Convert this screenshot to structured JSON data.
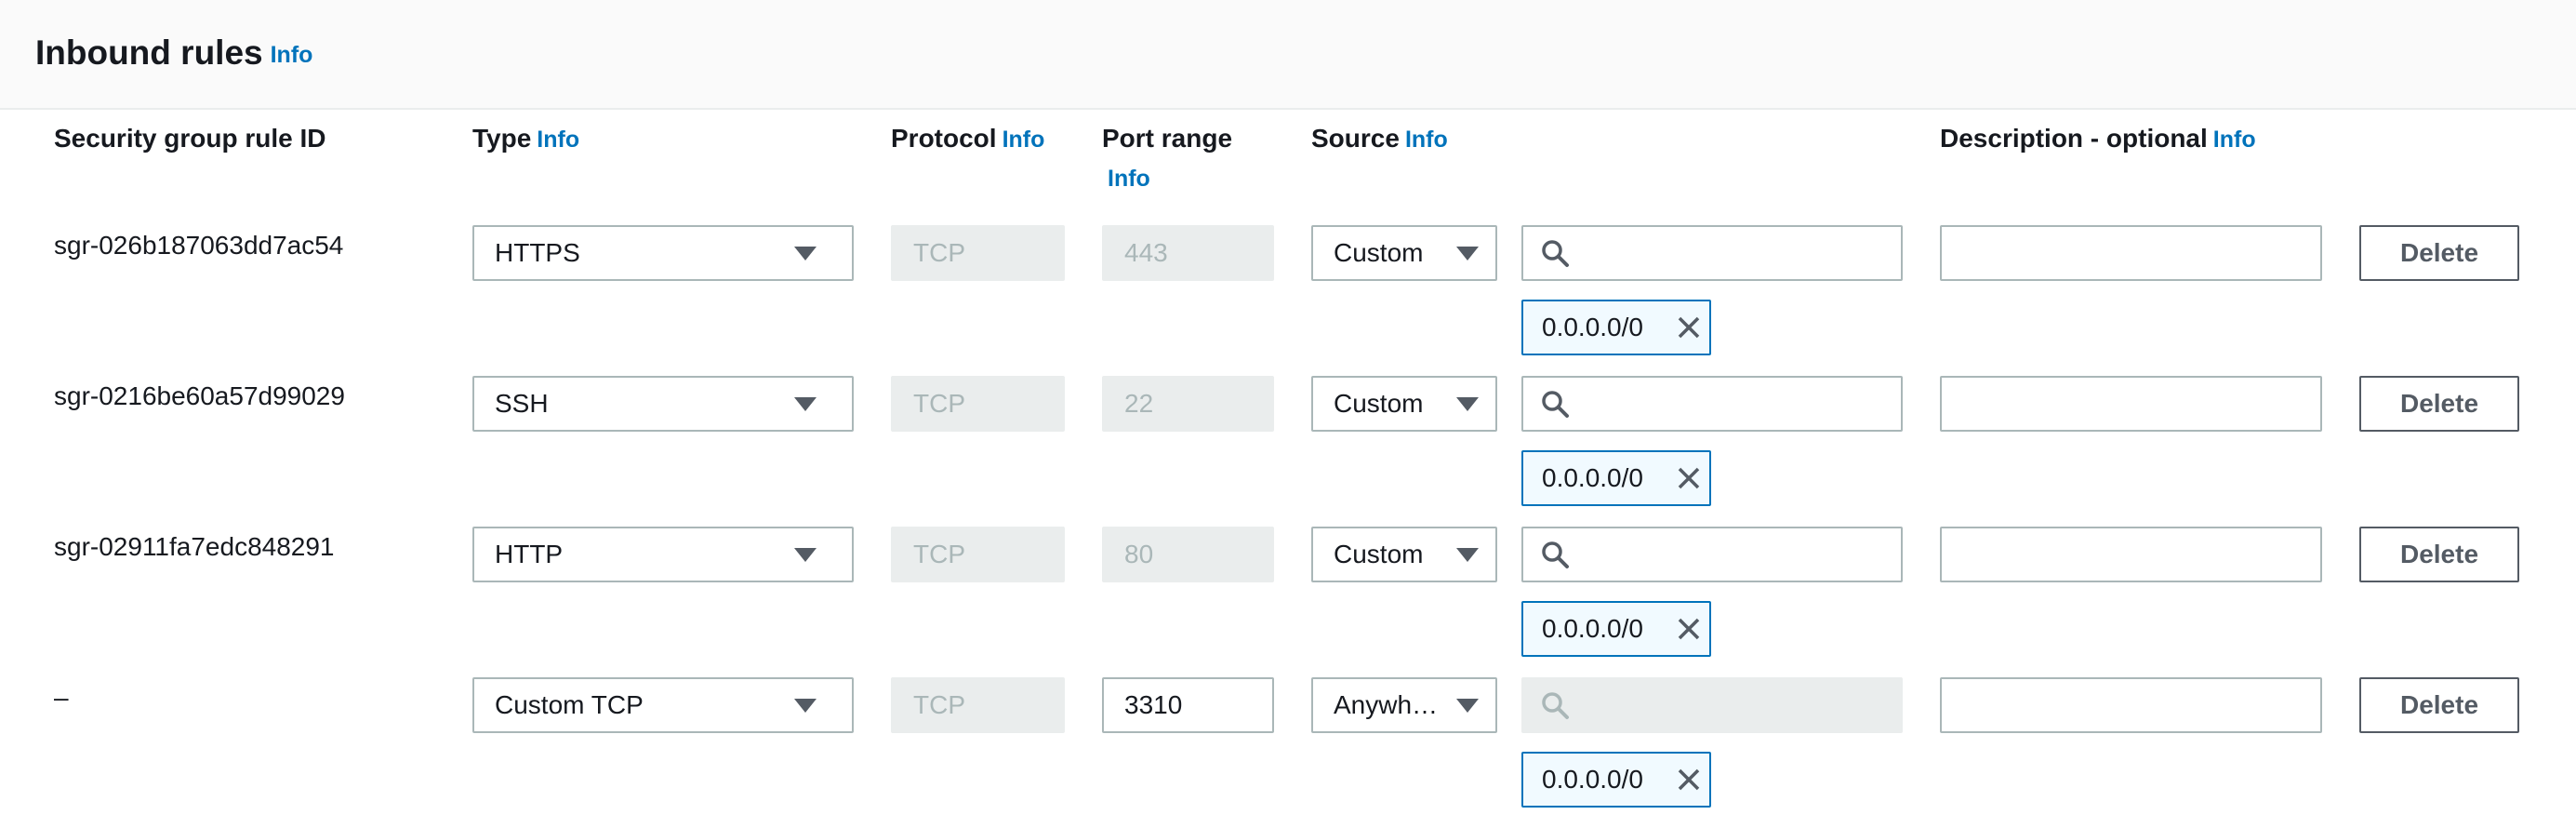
{
  "header": {
    "title": "Inbound rules",
    "info": "Info"
  },
  "columns": {
    "rule_id": "Security group rule ID",
    "type": "Type",
    "protocol": "Protocol",
    "port_range": "Port range",
    "source": "Source",
    "description": "Description - optional",
    "info": "Info"
  },
  "rules": [
    {
      "id": "sgr-026b187063dd7ac54",
      "type": "HTTPS",
      "protocol": "TCP",
      "port": "443",
      "source_type": "Custom",
      "token": "0.0.0.0/0",
      "delete": "Delete"
    },
    {
      "id": "sgr-0216be60a57d99029",
      "type": "SSH",
      "protocol": "TCP",
      "port": "22",
      "source_type": "Custom",
      "token": "0.0.0.0/0",
      "delete": "Delete"
    },
    {
      "id": "sgr-02911fa7edc848291",
      "type": "HTTP",
      "protocol": "TCP",
      "port": "80",
      "source_type": "Custom",
      "token": "0.0.0.0/0",
      "delete": "Delete"
    },
    {
      "id": "–",
      "type": "Custom TCP",
      "protocol": "TCP",
      "port": "3310",
      "source_type": "Anywh…",
      "token": "0.0.0.0/0",
      "delete": "Delete"
    }
  ],
  "icons": {
    "search": "search-icon",
    "caret": "caret-down-icon",
    "remove": "close-icon"
  },
  "colors": {
    "link": "#0073bb",
    "disabled_bg": "#eaeded",
    "token_border": "#0073bb",
    "token_bg": "#f1faff"
  }
}
